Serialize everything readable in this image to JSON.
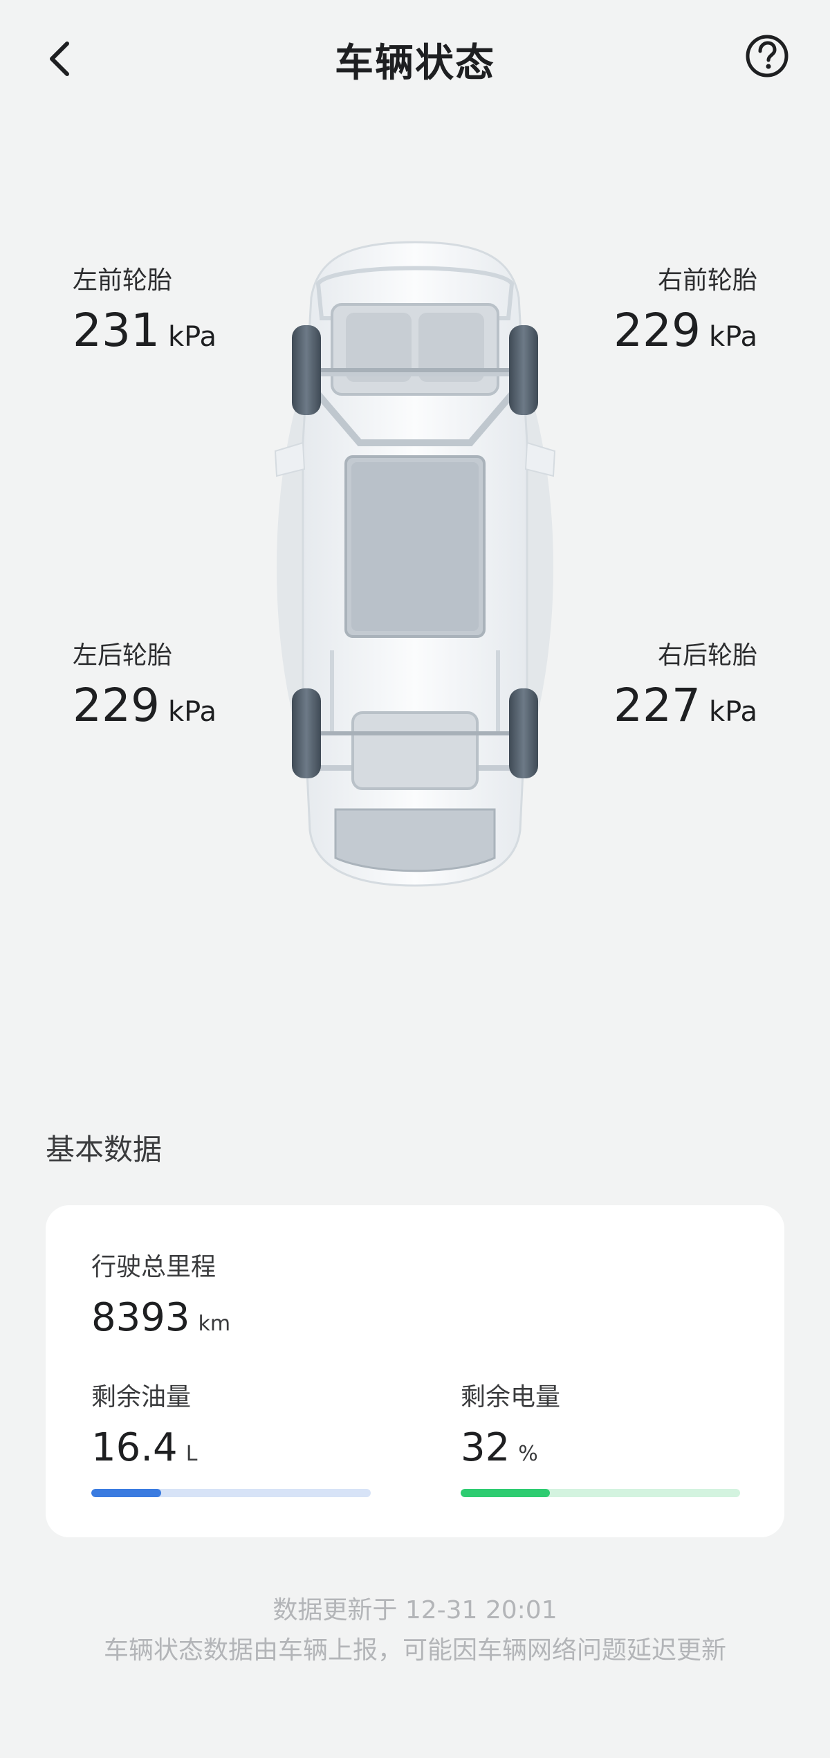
{
  "header": {
    "title": "车辆状态"
  },
  "tires": {
    "front_left": {
      "label": "左前轮胎",
      "value": "231",
      "unit": "kPa"
    },
    "front_right": {
      "label": "右前轮胎",
      "value": "229",
      "unit": "kPa"
    },
    "rear_left": {
      "label": "左后轮胎",
      "value": "229",
      "unit": "kPa"
    },
    "rear_right": {
      "label": "右后轮胎",
      "value": "227",
      "unit": "kPa"
    }
  },
  "basic": {
    "title": "基本数据",
    "mileage": {
      "label": "行驶总里程",
      "value": "8393",
      "unit": "km"
    },
    "fuel": {
      "label": "剩余油量",
      "value": "16.4",
      "unit": "L",
      "level_fraction": 0.25,
      "fill_color": "#3a7be0",
      "track_color": "#d7e3f7"
    },
    "battery": {
      "label": "剩余电量",
      "value": "32",
      "unit": "%",
      "level_fraction": 0.32,
      "fill_color": "#2ecc71",
      "track_color": "#d3f3df"
    }
  },
  "footer": {
    "updated": "数据更新于 12-31 20:01",
    "note": "车辆状态数据由车辆上报，可能因车辆网络问题延迟更新"
  },
  "icons": {
    "back": "chevron-left-icon",
    "help": "question-circle-icon"
  }
}
